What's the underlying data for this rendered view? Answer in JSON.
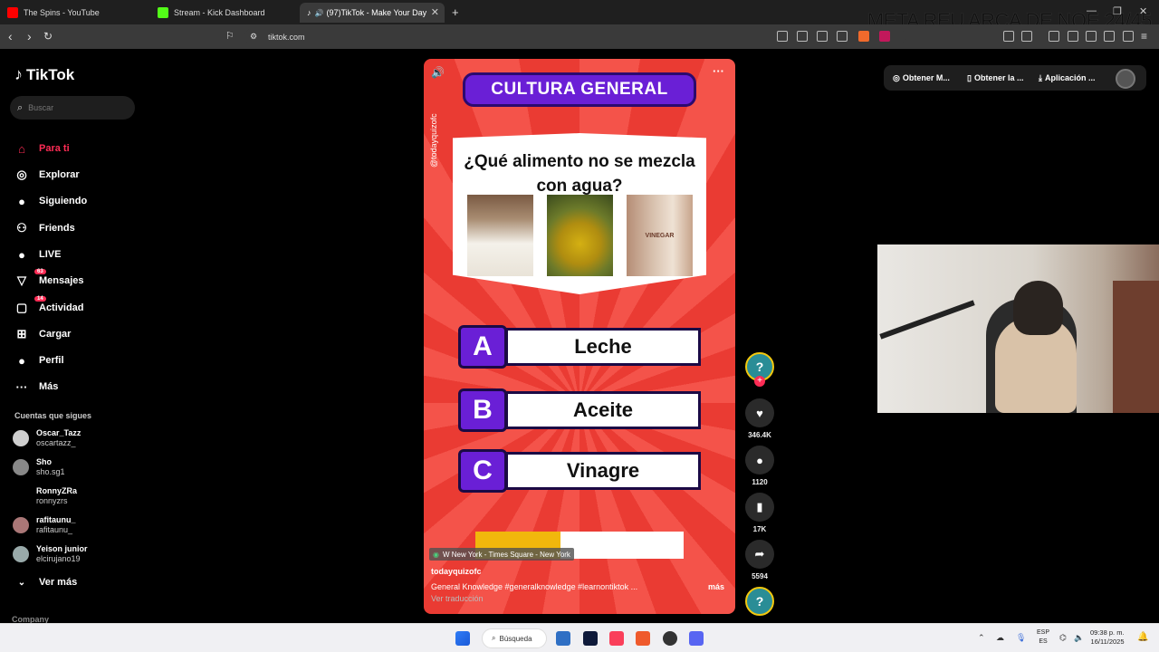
{
  "browser": {
    "tabs": [
      {
        "title": "The Spins - YouTube",
        "color": "#ff0000",
        "active": false
      },
      {
        "title": "Stream - Kick Dashboard",
        "color": "#53fc18",
        "active": false
      },
      {
        "title": "(97)TikTok - Make Your Day",
        "color": "#ffffff",
        "active": true
      }
    ],
    "new_tab": "+",
    "overlay_text": "META REU ARCA DE NOE 24/45",
    "url": "tiktok.com"
  },
  "sidebar": {
    "logo": "TikTok",
    "search_placeholder": "Buscar",
    "nav": [
      {
        "label": "Para ti",
        "icon": "home-icon",
        "glyph": "⌂",
        "active": true
      },
      {
        "label": "Explorar",
        "icon": "compass-icon",
        "glyph": "◎"
      },
      {
        "label": "Siguiendo",
        "icon": "following-avatar-icon",
        "glyph": "●"
      },
      {
        "label": "Friends",
        "icon": "friends-icon",
        "glyph": "⚇"
      },
      {
        "label": "LIVE",
        "icon": "live-icon",
        "glyph": "●"
      },
      {
        "label": "Mensajes",
        "icon": "messages-icon",
        "glyph": "▽",
        "badge": "63"
      },
      {
        "label": "Actividad",
        "icon": "activity-icon",
        "glyph": "▢",
        "badge": "14"
      },
      {
        "label": "Cargar",
        "icon": "upload-icon",
        "glyph": "⊞"
      },
      {
        "label": "Perfil",
        "icon": "profile-icon",
        "glyph": "●"
      },
      {
        "label": "Más",
        "icon": "more-icon",
        "glyph": "···"
      }
    ],
    "following_title": "Cuentas que sigues",
    "accounts": [
      {
        "name": "Oscar_Tazz",
        "handle": "oscartazz_"
      },
      {
        "name": "Sho",
        "handle": "sho.sg1"
      },
      {
        "name": "RonnyZRa",
        "handle": "ronnyzrs"
      },
      {
        "name": "rafitaunu_",
        "handle": "rafitaunu_"
      },
      {
        "name": "Yeison junior",
        "handle": "elcirujano19"
      }
    ],
    "see_more": "Ver más",
    "company": "Company"
  },
  "video": {
    "banner": "CULTURA GENERAL",
    "question": "¿Qué alimento no se mezcla con agua?",
    "vertical_handle": "@todayquizofc",
    "vinegar_label": "VINEGAR",
    "answers": [
      {
        "letter": "A",
        "text": "Leche"
      },
      {
        "letter": "B",
        "text": "Aceite"
      },
      {
        "letter": "C",
        "text": "Vinagre"
      }
    ],
    "timer_progress": 0.41,
    "location": "W New York - Times Square - New York",
    "author": "todayquizofc",
    "description": "General Knowledge  #generalknowledge  #learnontiktok  ...",
    "more": "más",
    "translate": "Ver traducción"
  },
  "actions": {
    "likes": "346.4K",
    "comments": "1120",
    "saves": "17K",
    "shares": "5594"
  },
  "topright": {
    "link1": "Obtener M...",
    "link2": "Obtener la ...",
    "link3": "Aplicación ..."
  },
  "taskbar": {
    "search": "Búsqueda",
    "lang_top": "ESP",
    "lang_bottom": "ES",
    "time": "09:38 p. m.",
    "date": "16/11/2025"
  }
}
